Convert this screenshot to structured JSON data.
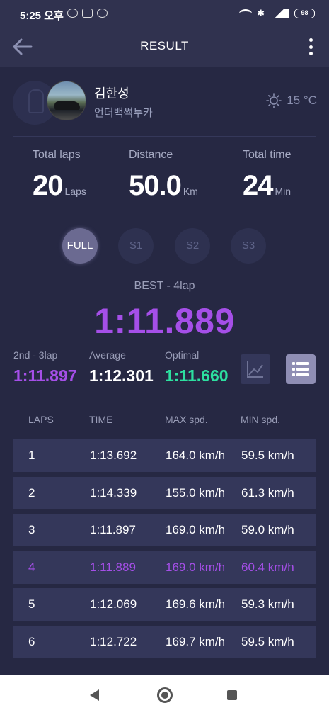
{
  "status_bar": {
    "time": "5:25 오후",
    "battery": "98",
    "network": "4G+"
  },
  "app_bar": {
    "title": "RESULT"
  },
  "profile": {
    "name": "김한성",
    "car": "언더백썩투카",
    "temperature": "15 °C"
  },
  "stats": {
    "total_laps": {
      "label": "Total laps",
      "value": "20",
      "unit": "Laps"
    },
    "distance": {
      "label": "Distance",
      "value": "50.0",
      "unit": "Km"
    },
    "total_time": {
      "label": "Total time",
      "value": "24",
      "unit": "Min"
    }
  },
  "segments": {
    "selected": "FULL",
    "items": [
      "FULL",
      "S1",
      "S2",
      "S3"
    ]
  },
  "best": {
    "label": "BEST - 4lap",
    "time": "1:11.889"
  },
  "summary": {
    "second": {
      "label": "2nd - 3lap",
      "value": "1:11.897"
    },
    "average": {
      "label": "Average",
      "value": "1:12.301"
    },
    "optimal": {
      "label": "Optimal",
      "value": "1:11.660"
    }
  },
  "table": {
    "headers": [
      "LAPS",
      "TIME",
      "MAX spd.",
      "MIN spd."
    ],
    "best_lap": "4",
    "rows": [
      [
        "1",
        "1:13.692",
        "164.0 km/h",
        "59.5 km/h"
      ],
      [
        "2",
        "1:14.339",
        "155.0 km/h",
        "61.3 km/h"
      ],
      [
        "3",
        "1:11.897",
        "169.0 km/h",
        "59.0 km/h"
      ],
      [
        "4",
        "1:11.889",
        "169.0 km/h",
        "60.4 km/h"
      ],
      [
        "5",
        "1:12.069",
        "169.6 km/h",
        "59.3 km/h"
      ],
      [
        "6",
        "1:12.722",
        "169.7 km/h",
        "59.5 km/h"
      ]
    ]
  },
  "colors": {
    "background": "#262843",
    "bar": "#30324f",
    "row": "#34375a",
    "best": "#a54fe8",
    "optimal": "#2de0a0",
    "muted": "#9a9eb8"
  }
}
